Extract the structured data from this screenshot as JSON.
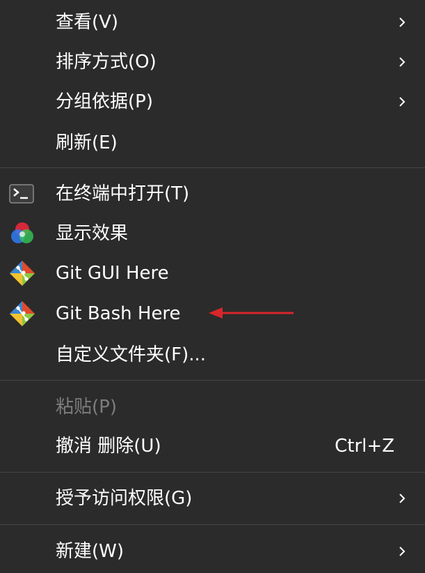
{
  "menu": {
    "items": [
      {
        "label": "查看(V)"
      },
      {
        "label": "排序方式(O)"
      },
      {
        "label": "分组依据(P)"
      },
      {
        "label": "刷新(E)"
      },
      {
        "label": "在终端中打开(T)",
        "icon": "terminal-icon"
      },
      {
        "label": "显示效果",
        "icon": "color-effects-icon"
      },
      {
        "label": "Git GUI Here",
        "icon": "git-icon"
      },
      {
        "label": "Git Bash Here",
        "icon": "git-icon"
      },
      {
        "label": "自定义文件夹(F)..."
      },
      {
        "label": "粘贴(P)",
        "disabled": true
      },
      {
        "label": "撤消 删除(U)",
        "shortcut": "Ctrl+Z"
      },
      {
        "label": "授予访问权限(G)"
      },
      {
        "label": "新建(W)"
      }
    ]
  },
  "colors": {
    "background": "#2b2b2b",
    "text": "#ffffff",
    "disabled_text": "#7d7d7d",
    "separator": "#454545",
    "annotation_arrow": "#d9262b"
  }
}
